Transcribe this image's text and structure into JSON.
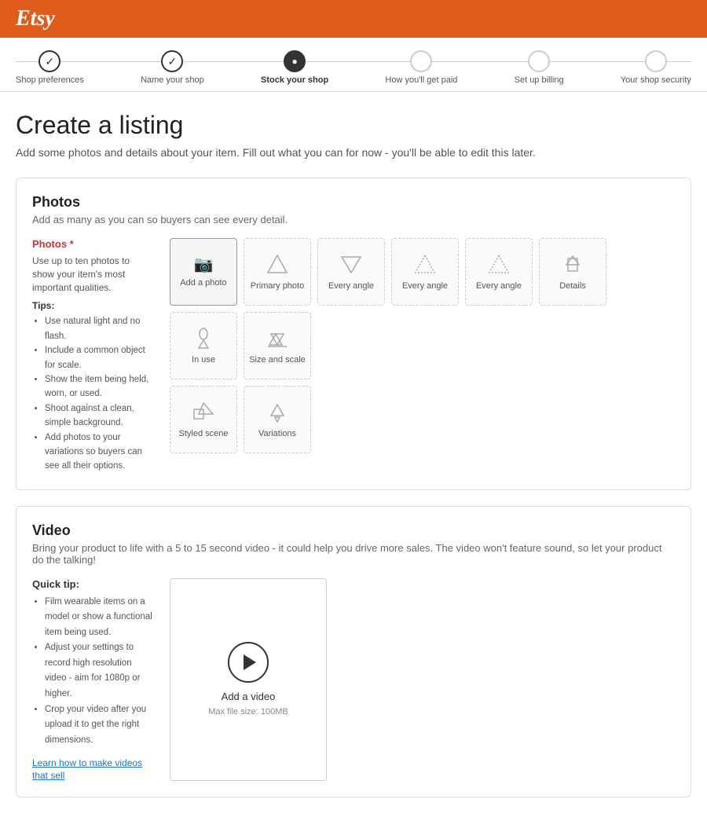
{
  "header": {
    "logo": "Etsy"
  },
  "progress": {
    "steps": [
      {
        "id": "shop-preferences",
        "label": "Shop preferences",
        "state": "completed"
      },
      {
        "id": "name-your-shop",
        "label": "Name your shop",
        "state": "completed"
      },
      {
        "id": "stock-your-shop",
        "label": "Stock your shop",
        "state": "active"
      },
      {
        "id": "how-youll-get-paid",
        "label": "How you'll get paid",
        "state": "inactive"
      },
      {
        "id": "set-up-billing",
        "label": "Set up billing",
        "state": "inactive"
      },
      {
        "id": "your-shop-security",
        "label": "Your shop security",
        "state": "inactive"
      }
    ]
  },
  "page": {
    "title": "Create a listing",
    "subtitle": "Add some photos and details about your item. Fill out what you can for now - you'll be able to edit this later."
  },
  "photos_section": {
    "title": "Photos",
    "description": "Add as many as you can so buyers can see every detail.",
    "sidebar_label": "Photos",
    "required": "*",
    "info_text": "Use up to ten photos to show your item's most important qualities.",
    "tips_label": "Tips:",
    "tips": [
      "Use natural light and no flash.",
      "Include a common object for scale.",
      "Show the item being held, worn, or used.",
      "Shoot against a clean, simple background.",
      "Add photos to your variations so buyers can see all their options."
    ],
    "add_photo_label": "Add a photo",
    "slots": [
      {
        "label": "Primary photo",
        "type": "triangle-up"
      },
      {
        "label": "Every angle",
        "type": "triangle-down"
      },
      {
        "label": "Every angle",
        "type": "triangle-up-outline"
      },
      {
        "label": "Every angle",
        "type": "triangle-up-outline"
      },
      {
        "label": "Details",
        "type": "triangle-multi"
      },
      {
        "label": "In use",
        "type": "triangle-drop"
      },
      {
        "label": "Size and scale",
        "type": "triangle-multi2"
      },
      {
        "label": "Styled scene",
        "type": "square-scene"
      },
      {
        "label": "Variations",
        "type": "tri-group"
      }
    ]
  },
  "video_section": {
    "title": "Video",
    "description": "Bring your product to life with a 5 to 15 second video - it could help you drive more sales. The video won't feature sound, so let your product do the talking!",
    "quick_tip_label": "Quick tip:",
    "tips": [
      "Film wearable items on a model or show a functional item being used.",
      "Adjust your settings to record high resolution video - aim for 1080p or higher.",
      "Crop your video after you upload it to get the right dimensions."
    ],
    "learn_link": "Learn how to make videos that sell",
    "add_video_label": "Add a video",
    "max_file_size": "Max file size: 100MB"
  }
}
